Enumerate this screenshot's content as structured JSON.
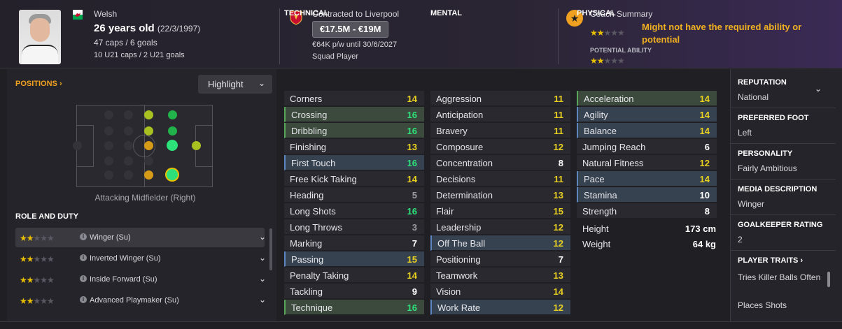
{
  "header": {
    "nationality": "Welsh",
    "age_text": "26 years old",
    "dob": "(22/3/1997)",
    "caps": "47 caps / 6 goals",
    "u21": "10 U21 caps / 2 U21 goals",
    "contract": "Contracted to Liverpool",
    "value": "€17.5M - €19M",
    "wage": "€64K p/w until 30/6/2027",
    "squad_status": "Squad Player",
    "coach_title": "Coach Summary",
    "coach_note": "Might not have the required ability or potential",
    "potential_label": "POTENTIAL ABILITY",
    "current_ability_stars": 2,
    "potential_ability_stars": 2
  },
  "positions": {
    "link": "POSITIONS",
    "highlight": "Highlight",
    "position_label": "Attacking Midfielder (Right)"
  },
  "roles": {
    "title": "ROLE AND DUTY",
    "items": [
      {
        "name": "Winger (Su)",
        "stars": 2
      },
      {
        "name": "Inverted Winger (Su)",
        "stars": 2
      },
      {
        "name": "Inside Forward (Su)",
        "stars": 2
      },
      {
        "name": "Advanced Playmaker (Su)",
        "stars": 2
      }
    ]
  },
  "technical": {
    "title": "TECHNICAL",
    "items": [
      {
        "name": "Corners",
        "value": "14"
      },
      {
        "name": "Crossing",
        "value": "16"
      },
      {
        "name": "Dribbling",
        "value": "16"
      },
      {
        "name": "Finishing",
        "value": "13"
      },
      {
        "name": "First Touch",
        "value": "16"
      },
      {
        "name": "Free Kick Taking",
        "value": "14"
      },
      {
        "name": "Heading",
        "value": "5"
      },
      {
        "name": "Long Shots",
        "value": "16"
      },
      {
        "name": "Long Throws",
        "value": "3"
      },
      {
        "name": "Marking",
        "value": "7"
      },
      {
        "name": "Passing",
        "value": "15"
      },
      {
        "name": "Penalty Taking",
        "value": "14"
      },
      {
        "name": "Tackling",
        "value": "9"
      },
      {
        "name": "Technique",
        "value": "16"
      }
    ]
  },
  "mental": {
    "title": "MENTAL",
    "items": [
      {
        "name": "Aggression",
        "value": "11"
      },
      {
        "name": "Anticipation",
        "value": "11"
      },
      {
        "name": "Bravery",
        "value": "11"
      },
      {
        "name": "Composure",
        "value": "12"
      },
      {
        "name": "Concentration",
        "value": "8"
      },
      {
        "name": "Decisions",
        "value": "11"
      },
      {
        "name": "Determination",
        "value": "13"
      },
      {
        "name": "Flair",
        "value": "15"
      },
      {
        "name": "Leadership",
        "value": "12"
      },
      {
        "name": "Off The Ball",
        "value": "12"
      },
      {
        "name": "Positioning",
        "value": "7"
      },
      {
        "name": "Teamwork",
        "value": "13"
      },
      {
        "name": "Vision",
        "value": "14"
      },
      {
        "name": "Work Rate",
        "value": "12"
      }
    ]
  },
  "physical": {
    "title": "PHYSICAL",
    "items": [
      {
        "name": "Acceleration",
        "value": "14"
      },
      {
        "name": "Agility",
        "value": "14"
      },
      {
        "name": "Balance",
        "value": "14"
      },
      {
        "name": "Jumping Reach",
        "value": "6"
      },
      {
        "name": "Natural Fitness",
        "value": "12"
      },
      {
        "name": "Pace",
        "value": "14"
      },
      {
        "name": "Stamina",
        "value": "10"
      },
      {
        "name": "Strength",
        "value": "8"
      }
    ],
    "height_label": "Height",
    "height": "173 cm",
    "weight_label": "Weight",
    "weight": "64 kg"
  },
  "info": {
    "reputation_label": "REPUTATION",
    "reputation": "National",
    "foot_label": "PREFERRED FOOT",
    "foot": "Left",
    "personality_label": "PERSONALITY",
    "personality": "Fairly Ambitious",
    "media_label": "MEDIA DESCRIPTION",
    "media": "Winger",
    "gk_label": "GOALKEEPER RATING",
    "gk": "2",
    "traits_label": "PLAYER TRAITS",
    "trait1": "Tries Killer Balls Often",
    "trait2": "Places Shots"
  },
  "colors": {
    "accent": "#f0a020",
    "star": "#e8c000",
    "high_value": "#2ee07a",
    "mid_value": "#e8d020",
    "highlight_green": "#3b4a3c",
    "highlight_blue": "#364250"
  },
  "icons": {
    "flag": "wales-flag-icon",
    "club": "liverpool-crest-icon",
    "coach": "star-icon",
    "info": "info-icon",
    "dropdown": "chevron-down-icon",
    "link_arrow": "chevron-right-icon"
  }
}
